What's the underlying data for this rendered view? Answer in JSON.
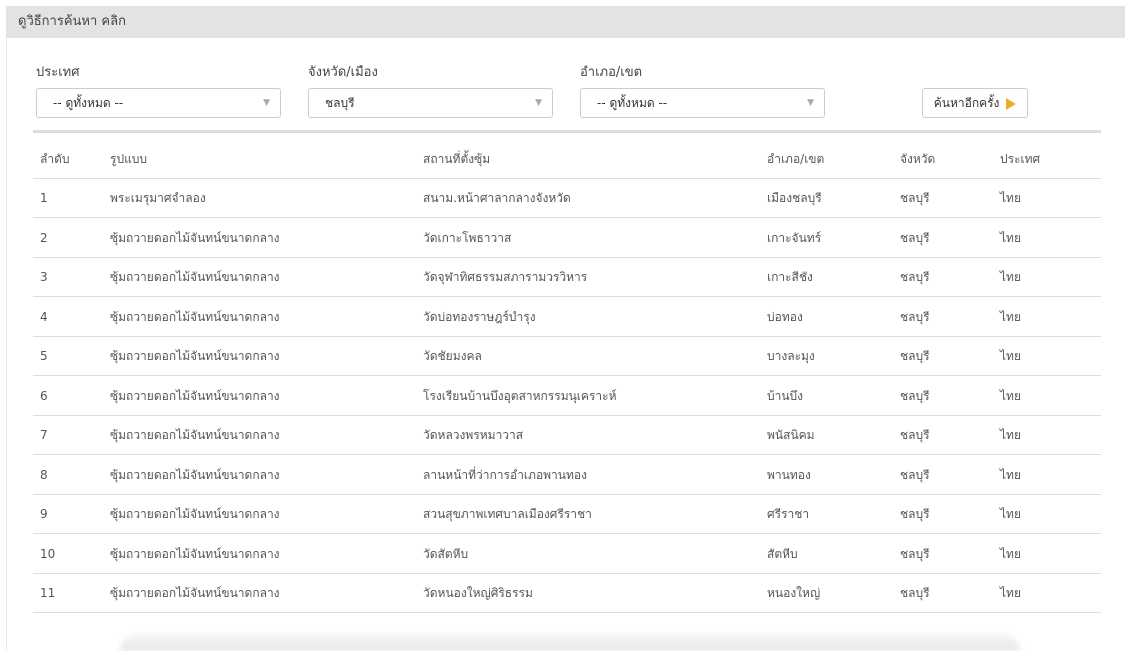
{
  "header": {
    "title": "ดูวิธีการค้นหา คลิก"
  },
  "filters": {
    "country": {
      "label": "ประเทศ",
      "value": "-- ดูทั้งหมด --"
    },
    "province": {
      "label": "จังหวัด/เมือง",
      "value": "ชลบุรี"
    },
    "district": {
      "label": "อำเภอ/เขต",
      "value": "-- ดูทั้งหมด --"
    },
    "search_button_label": "ค้นหาอีกครั้ง"
  },
  "table": {
    "columns": [
      "ลำดับ",
      "รูปแบบ",
      "สถานที่ตั้งซุ้ม",
      "อำเภอ/เขต",
      "จังหวัด",
      "ประเทศ"
    ],
    "rows": [
      {
        "no": "1",
        "type": "พระเมรุมาศจำลอง",
        "location": "สนาม.หน้าศาลากลางจังหวัด",
        "district": "เมืองชลบุรี",
        "province": "ชลบุรี",
        "country": "ไทย"
      },
      {
        "no": "2",
        "type": "ซุ้มถวายดอกไม้จันทน์ขนาดกลาง",
        "location": "วัดเกาะโพธาวาส",
        "district": "เกาะจันทร์",
        "province": "ชลบุรี",
        "country": "ไทย"
      },
      {
        "no": "3",
        "type": "ซุ้มถวายดอกไม้จันทน์ขนาดกลาง",
        "location": "วัดจุฬาทิศธรรมสภารามวรวิหาร",
        "district": "เกาะสีชัง",
        "province": "ชลบุรี",
        "country": "ไทย"
      },
      {
        "no": "4",
        "type": "ซุ้มถวายดอกไม้จันทน์ขนาดกลาง",
        "location": "วัดบ่อทองราษฎร์บำรุง",
        "district": "บ่อทอง",
        "province": "ชลบุรี",
        "country": "ไทย"
      },
      {
        "no": "5",
        "type": "ซุ้มถวายดอกไม้จันทน์ขนาดกลาง",
        "location": "วัดชัยมงคล",
        "district": "บางละมุง",
        "province": "ชลบุรี",
        "country": "ไทย"
      },
      {
        "no": "6",
        "type": "ซุ้มถวายดอกไม้จันทน์ขนาดกลาง",
        "location": "โรงเรียนบ้านบึงอุตสาหกรรมนุเคราะห์",
        "district": "บ้านบึง",
        "province": "ชลบุรี",
        "country": "ไทย"
      },
      {
        "no": "7",
        "type": "ซุ้มถวายดอกไม้จันทน์ขนาดกลาง",
        "location": "วัดหลวงพรหมาวาส",
        "district": "พนัสนิคม",
        "province": "ชลบุรี",
        "country": "ไทย"
      },
      {
        "no": "8",
        "type": "ซุ้มถวายดอกไม้จันทน์ขนาดกลาง",
        "location": "ลานหน้าที่ว่าการอำเภอพานทอง",
        "district": "พานทอง",
        "province": "ชลบุรี",
        "country": "ไทย"
      },
      {
        "no": "9",
        "type": "ซุ้มถวายดอกไม้จันทน์ขนาดกลาง",
        "location": "สวนสุขภาพเทศบาลเมืองศรีราชา",
        "district": "ศรีราชา",
        "province": "ชลบุรี",
        "country": "ไทย"
      },
      {
        "no": "10",
        "type": "ซุ้มถวายดอกไม้จันทน์ขนาดกลาง",
        "location": "วัดสัตหีบ",
        "district": "สัตหีบ",
        "province": "ชลบุรี",
        "country": "ไทย"
      },
      {
        "no": "11",
        "type": "ซุ้มถวายดอกไม้จันทน์ขนาดกลาง",
        "location": "วัดหนองใหญ่ศิริธรรม",
        "district": "หนองใหญ่",
        "province": "ชลบุรี",
        "country": "ไทย"
      }
    ]
  },
  "icons": {
    "select_chevron": "chevron-down-icon",
    "search_arrow": "play-arrow-icon"
  },
  "colors": {
    "accent_arrow": "#f0a830",
    "header_bar": "#e3e3e3"
  }
}
